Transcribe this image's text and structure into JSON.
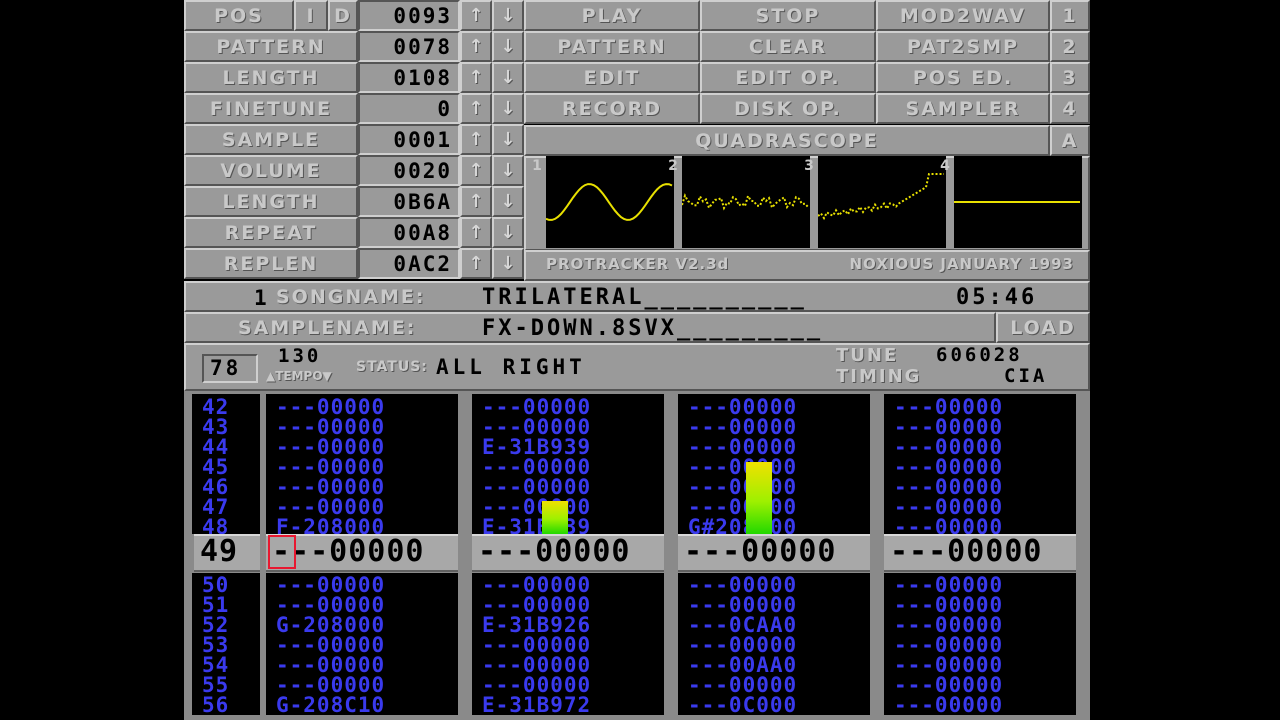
{
  "left_panel": [
    {
      "label": "POS",
      "value": "0093",
      "i": "I",
      "d": "D"
    },
    {
      "label": "PATTERN",
      "value": "0078"
    },
    {
      "label": "LENGTH",
      "value": "0108"
    },
    {
      "label": "FINETUNE",
      "value": "0"
    },
    {
      "label": "SAMPLE",
      "value": "0001"
    },
    {
      "label": "VOLUME",
      "value": "0020"
    },
    {
      "label": "LENGTH",
      "value": "0B6A"
    },
    {
      "label": "REPEAT",
      "value": "00A8"
    },
    {
      "label": "REPLEN",
      "value": "0AC2"
    }
  ],
  "icons": {
    "up": "arrow-up-icon",
    "down": "arrow-down-icon"
  },
  "arrow_up": "↑",
  "arrow_down": "↓",
  "menu": [
    [
      "PLAY",
      "STOP",
      "MOD2WAV",
      "1"
    ],
    [
      "PATTERN",
      "CLEAR",
      "PAT2SMP",
      "2"
    ],
    [
      "EDIT",
      "EDIT OP.",
      "POS ED.",
      "3"
    ],
    [
      "RECORD",
      "DISK OP.",
      "SAMPLER",
      "4"
    ]
  ],
  "quadrascope": {
    "title": "QUADRASCOPE",
    "key": "A",
    "channels": [
      "1",
      "2",
      "3",
      "4"
    ]
  },
  "credits": {
    "left": "PROTRACKER V2.3d",
    "right": "NOXIOUS JANUARY 1993"
  },
  "song": {
    "number": "1",
    "label": "SONGNAME:",
    "name": "TRILATERAL__________",
    "time": "05:46"
  },
  "sample": {
    "label": "SAMPLENAME:",
    "name": "FX-DOWN.8SVX_________",
    "load": "LOAD"
  },
  "status_bar": {
    "pattern": "78",
    "tempo_value": "130",
    "tempo_label": "▲TEMPO▼",
    "status_label": "STATUS:",
    "status": "ALL RIGHT",
    "tune_label": "TUNE",
    "tune_value": "606028",
    "timing_label": "TIMING",
    "timing_value": "CIA"
  },
  "pattern": {
    "current_row": "49",
    "rows_before": [
      "42",
      "43",
      "44",
      "45",
      "46",
      "47",
      "48"
    ],
    "rows_after": [
      "50",
      "51",
      "52",
      "53",
      "54",
      "55",
      "56"
    ],
    "channels": [
      {
        "before": [
          "---00000",
          "---00000",
          "---00000",
          "---00000",
          "---00000",
          "---00000",
          "F-208000"
        ],
        "current": "---00000",
        "after": [
          "---00000",
          "---00000",
          "G-208000",
          "---00000",
          "---00000",
          "---00000",
          "G-208C10"
        ]
      },
      {
        "before": [
          "---00000",
          "---00000",
          "E-31B939",
          "---00000",
          "---00000",
          "---00000",
          "E-31B939"
        ],
        "current": "---00000",
        "after": [
          "---00000",
          "---00000",
          "E-31B926",
          "---00000",
          "---00000",
          "---00000",
          "E-31B972"
        ]
      },
      {
        "before": [
          "---00000",
          "---00000",
          "---00000",
          "---00000",
          "---00000",
          "---00000",
          "G#208000"
        ],
        "current": "---00000",
        "after": [
          "---00000",
          "---00000",
          "---0CAA0",
          "---00000",
          "---00AA0",
          "---00000",
          "---0C000"
        ]
      },
      {
        "before": [
          "---00000",
          "---00000",
          "---00000",
          "---00000",
          "---00000",
          "---00000",
          "---00000"
        ],
        "current": "---00000",
        "after": [
          "---00000",
          "---00000",
          "---00000",
          "---00000",
          "---00000",
          "---00000",
          "---00000"
        ]
      }
    ],
    "vu_levels": [
      0.92,
      0.0,
      0.26,
      0.57,
      0.0
    ]
  }
}
